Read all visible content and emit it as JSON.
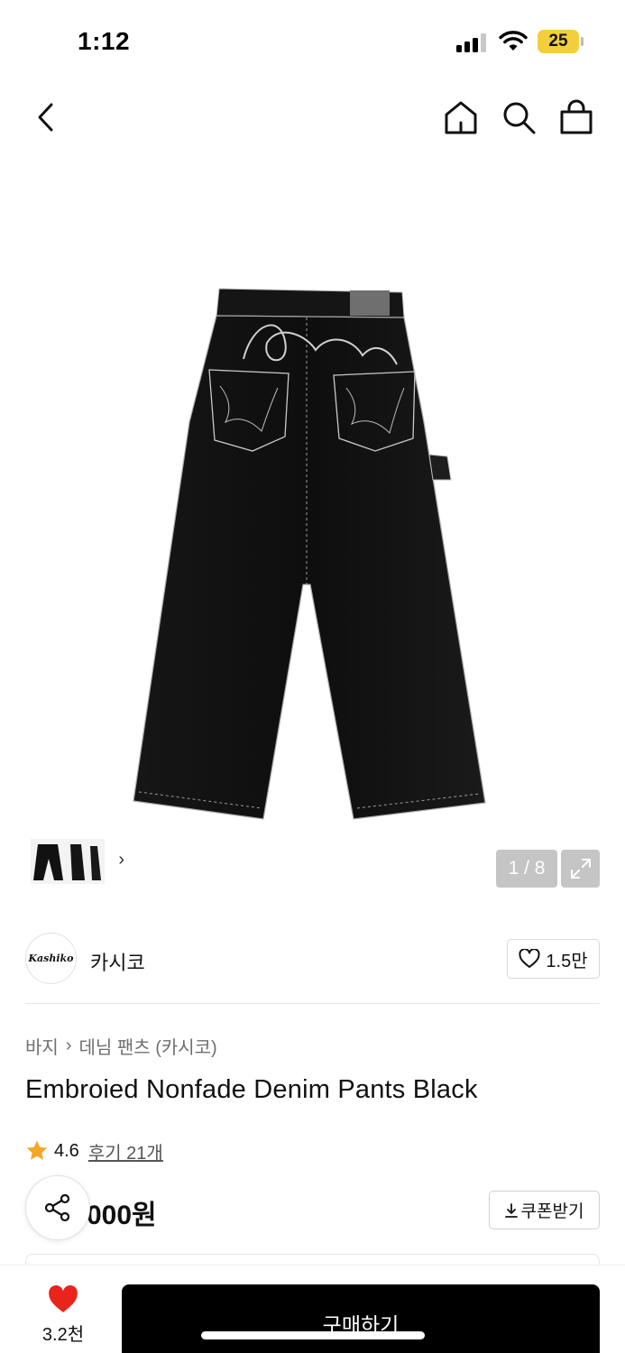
{
  "status_bar": {
    "time": "1:12",
    "battery": "25"
  },
  "nav": {
    "back_icon": "chevron-left-icon",
    "home_icon": "home-icon",
    "search_icon": "search-icon",
    "cart_icon": "shopping-bag-icon"
  },
  "gallery": {
    "page_indicator": "1 / 8",
    "thumb_arrow": "›"
  },
  "brand": {
    "logo_text": "Kashiko",
    "name": "카시코",
    "like_count": "1.5만"
  },
  "breadcrumb": {
    "category": "바지",
    "separator": "›",
    "subcategory": "데님 팬츠 (카시코)"
  },
  "product": {
    "title": "Embroied Nonfade Denim Pants Black",
    "rating": "4.6",
    "review_link": "후기 21개",
    "price_visible": "000원"
  },
  "coupon": {
    "label": "쿠폰받기"
  },
  "bottom_bar": {
    "wish_count": "3.2천",
    "buy_label": "구매하기"
  },
  "colors": {
    "accent_red": "#e8241c",
    "star": "#f5a623",
    "battery": "#f2cf3b"
  }
}
